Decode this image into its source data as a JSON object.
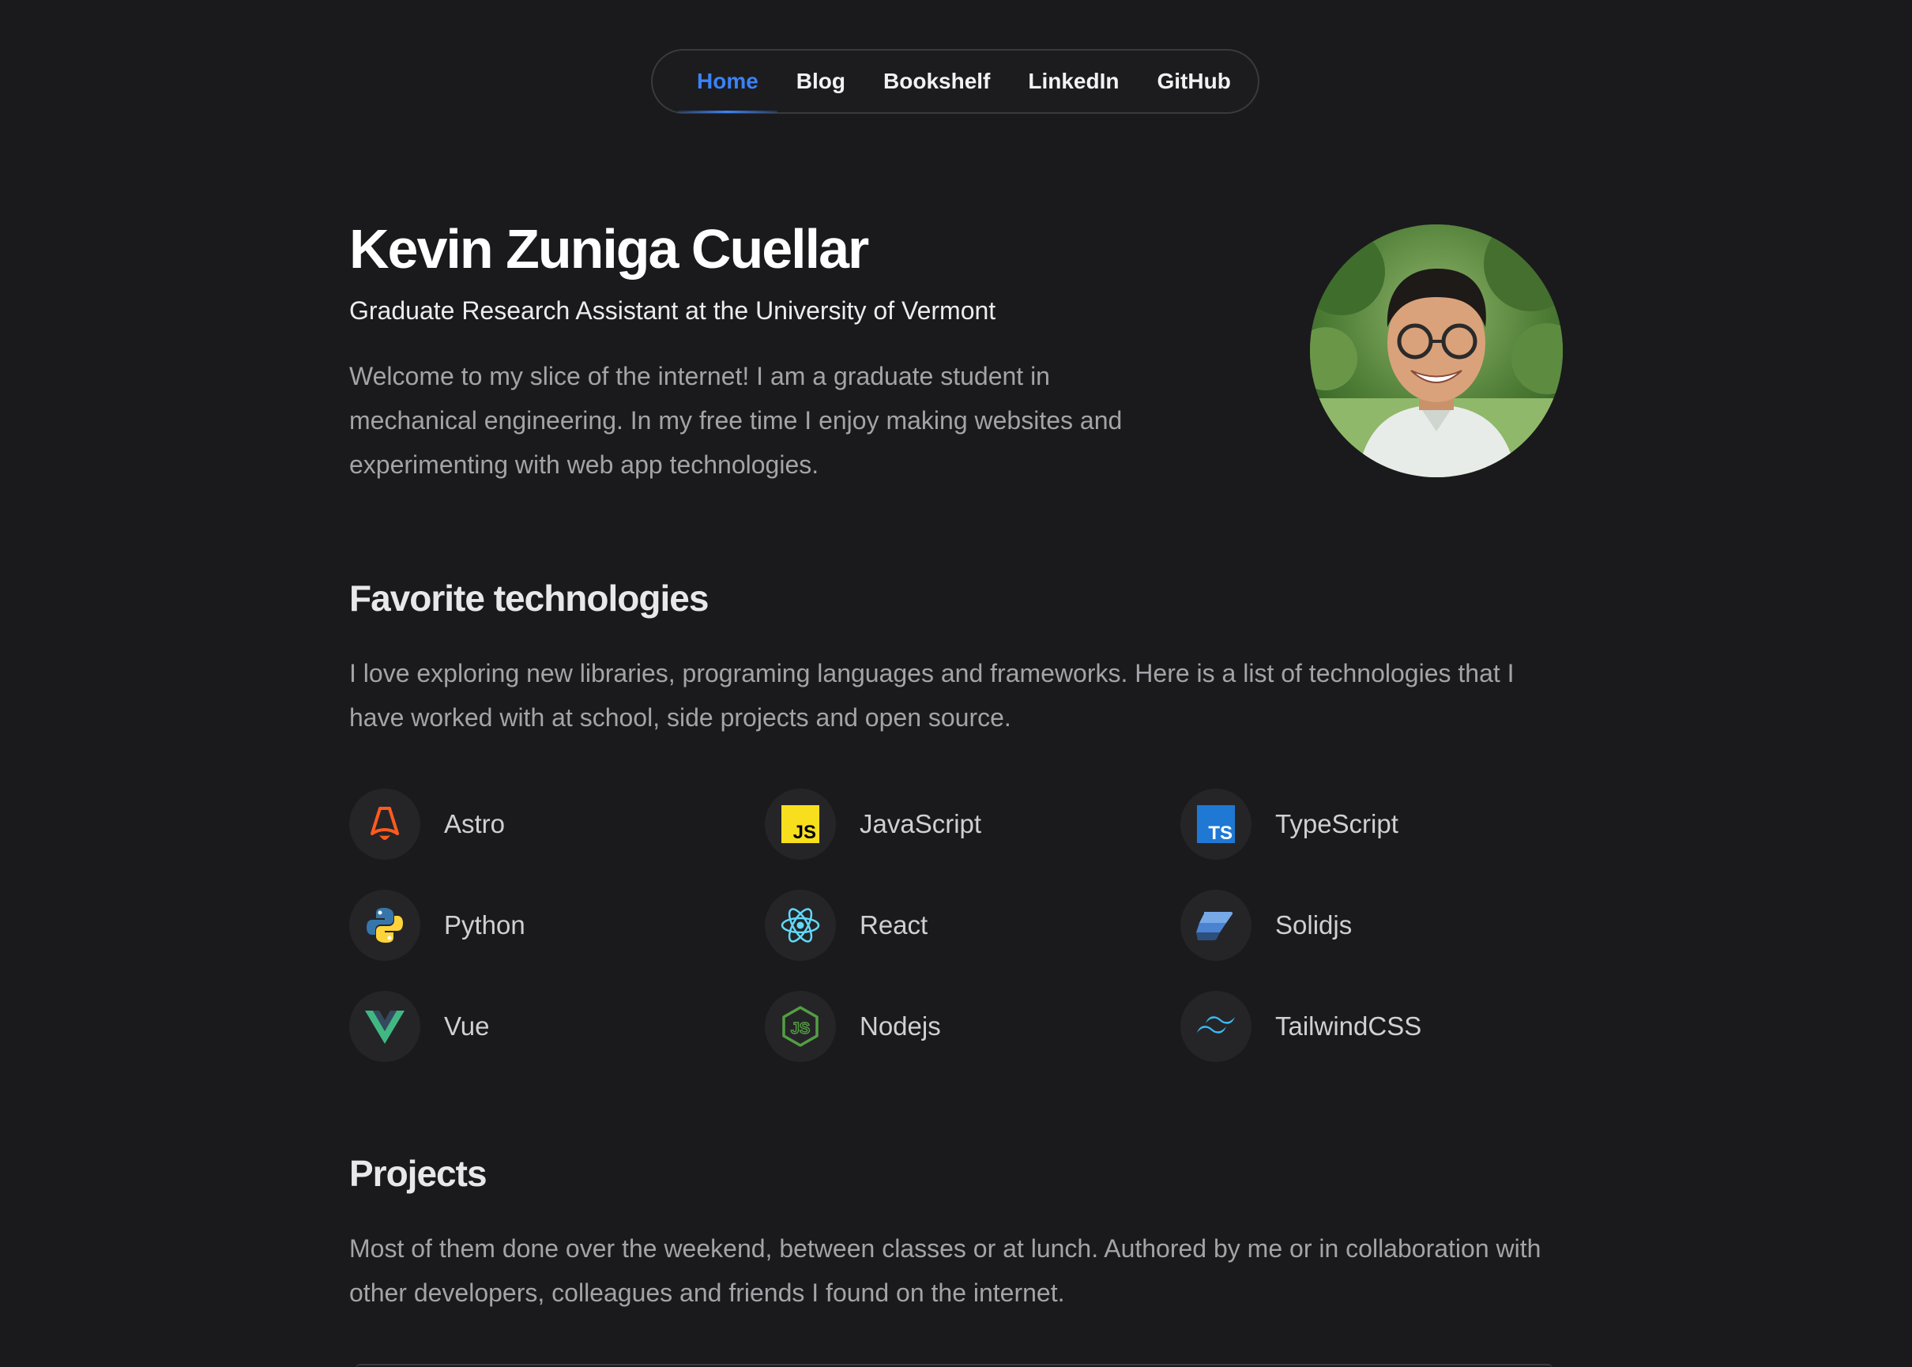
{
  "nav": {
    "items": [
      {
        "label": "Home",
        "active": true
      },
      {
        "label": "Blog"
      },
      {
        "label": "Bookshelf"
      },
      {
        "label": "LinkedIn"
      },
      {
        "label": "GitHub"
      }
    ]
  },
  "hero": {
    "name": "Kevin Zuniga Cuellar",
    "role": "Graduate Research Assistant at the University of Vermont",
    "intro": "Welcome to my slice of the internet! I am a graduate student in mechanical engineering. In my free time I enjoy making websites and experimenting with web app technologies."
  },
  "technologies": {
    "title": "Favorite technologies",
    "description": "I love exploring new libraries, programing languages and frameworks. Here is a list of technologies that I have worked with at school, side projects and open source.",
    "items": [
      {
        "label": "Astro",
        "icon": "astro-icon"
      },
      {
        "label": "JavaScript",
        "icon": "javascript-icon"
      },
      {
        "label": "TypeScript",
        "icon": "typescript-icon"
      },
      {
        "label": "Python",
        "icon": "python-icon"
      },
      {
        "label": "React",
        "icon": "react-icon"
      },
      {
        "label": "Solidjs",
        "icon": "solidjs-icon"
      },
      {
        "label": "Vue",
        "icon": "vue-icon"
      },
      {
        "label": "Nodejs",
        "icon": "nodejs-icon"
      },
      {
        "label": "TailwindCSS",
        "icon": "tailwindcss-icon"
      }
    ]
  },
  "projects": {
    "title": "Projects",
    "description": "Most of them done over the weekend, between classes or at lunch. Authored by me or in collaboration with other developers, colleagues and friends I found on the internet."
  },
  "colors": {
    "background": "#1a1a1c",
    "accent": "#3b82f6",
    "muted_text": "#a3a3a8"
  }
}
